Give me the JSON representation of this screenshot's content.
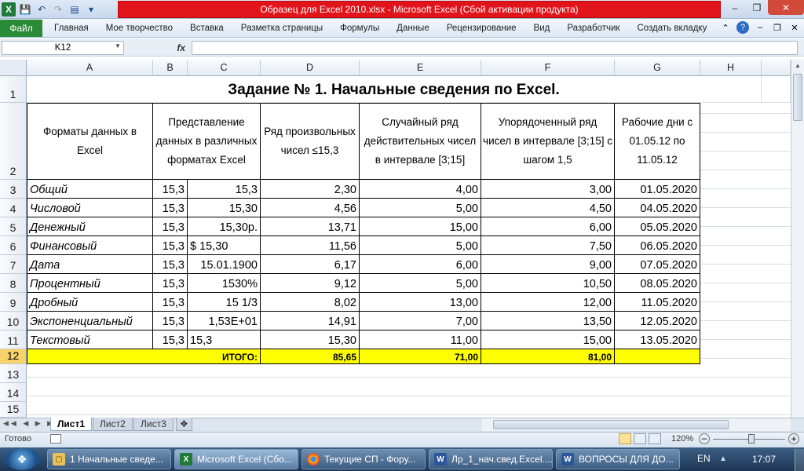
{
  "window": {
    "title": "Образец для Excel 2010.xlsx  -  Microsoft Excel (Сбой активации продукта)"
  },
  "ribbon": {
    "file_tab": "Файл",
    "tabs": [
      "Главная",
      "Мое творчество",
      "Вставка",
      "Разметка страницы",
      "Формулы",
      "Данные",
      "Рецензирование",
      "Вид",
      "Разработчик",
      "Создать вкладку"
    ]
  },
  "formula_bar": {
    "name_box": "K12",
    "fx": "fx",
    "value": ""
  },
  "columns": [
    "A",
    "B",
    "C",
    "D",
    "E",
    "F",
    "G",
    "H"
  ],
  "rows": [
    "1",
    "2",
    "3",
    "4",
    "5",
    "6",
    "7",
    "8",
    "9",
    "10",
    "11",
    "12",
    "13",
    "14",
    "15"
  ],
  "sheet": {
    "title": "Задание № 1. Начальные сведения по Excel.",
    "headers": {
      "a": "Форматы данных в Excel",
      "bc": "Представление данных в различных форматах Excel",
      "d": "Ряд произвольных чисел ≤15,3",
      "e": "Случайный ряд действительных чисел в интервале [3;15]",
      "f": "Упорядоченный ряд чисел в интервале [3;15] с шагом 1,5",
      "g": "Рабочие дни с 01.05.12 по 11.05.12"
    },
    "data_rows": [
      {
        "a": "Общий",
        "b": "15,3",
        "c": "15,3",
        "d": "2,30",
        "e": "4,00",
        "f": "3,00",
        "g": "01.05.2020"
      },
      {
        "a": "Числовой",
        "b": "15,3",
        "c": "15,30",
        "d": "4,56",
        "e": "5,00",
        "f": "4,50",
        "g": "04.05.2020"
      },
      {
        "a": "Денежный",
        "b": "15,3",
        "c": "15,30р.",
        "d": "13,71",
        "e": "15,00",
        "f": "6,00",
        "g": "05.05.2020"
      },
      {
        "a": "Финансовый",
        "b": "15,3",
        "c": "$      15,30",
        "d": "11,56",
        "e": "5,00",
        "f": "7,50",
        "g": "06.05.2020"
      },
      {
        "a": "Дата",
        "b": "15,3",
        "c": "15.01.1900",
        "d": "6,17",
        "e": "6,00",
        "f": "9,00",
        "g": "07.05.2020"
      },
      {
        "a": "Процентный",
        "b": "15,3",
        "c": "1530%",
        "d": "9,12",
        "e": "5,00",
        "f": "10,50",
        "g": "08.05.2020"
      },
      {
        "a": "Дробный",
        "b": "15,3",
        "c": "15 1/3",
        "d": "8,02",
        "e": "13,00",
        "f": "12,00",
        "g": "11.05.2020"
      },
      {
        "a": "Экспоненциальный",
        "b": "15,3",
        "c": "1,53E+01",
        "d": "14,91",
        "e": "7,00",
        "f": "13,50",
        "g": "12.05.2020"
      },
      {
        "a": "Текстовый",
        "b": "15,3",
        "c": "15,3",
        "d": "15,30",
        "e": "11,00",
        "f": "15,00",
        "g": "13.05.2020"
      }
    ],
    "total": {
      "label": "ИТОГО:",
      "d": "85,65",
      "e": "71,00",
      "f": "81,00"
    }
  },
  "sheet_tabs": [
    "Лист1",
    "Лист2",
    "Лист3"
  ],
  "status": {
    "ready": "Готово",
    "zoom": "120%"
  },
  "taskbar": {
    "items": [
      "1 Начальные сведе...",
      "Microsoft Excel (Сбо...",
      "Текущие СП - Фору...",
      "Лр_1_нач.свед.Excel....",
      "ВОПРОСЫ  ДЛЯ  ДО..."
    ],
    "lang": "EN",
    "time": "17:07"
  }
}
